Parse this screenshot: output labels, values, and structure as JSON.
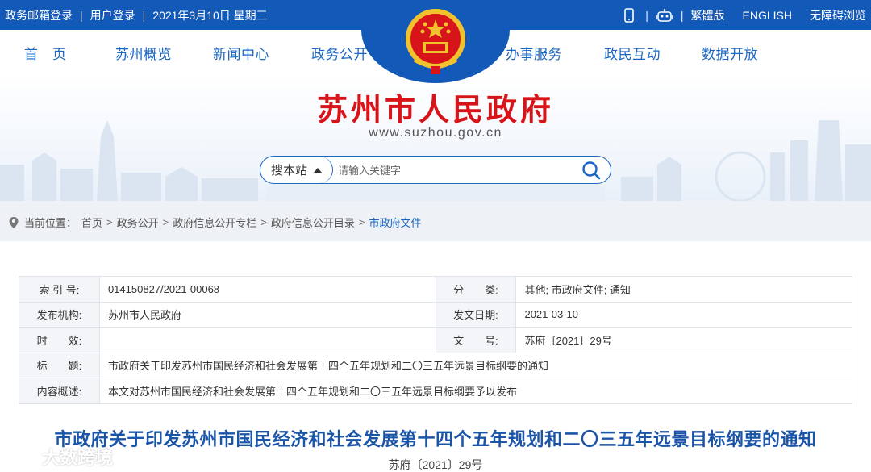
{
  "topbar": {
    "left": [
      "政务邮箱登录",
      "用户登录",
      "2021年3月10日 星期三"
    ],
    "separator": "|",
    "right": {
      "traditional": "繁體版",
      "english": "ENGLISH",
      "accessible": "无障碍浏览"
    }
  },
  "nav": {
    "items": [
      "首　页",
      "苏州概览",
      "新闻中心",
      "政务公开",
      "办事服务",
      "政民互动",
      "数据开放"
    ]
  },
  "header": {
    "title": "苏州市人民政府",
    "url": "www.suzhou.gov.cn"
  },
  "search": {
    "scope": "搜本站",
    "placeholder": "请输入关键字"
  },
  "breadcrumb": {
    "label": "当前位置：",
    "items": [
      "首页",
      "政务公开",
      "政府信息公开专栏",
      "政府信息公开目录"
    ],
    "current": "市政府文件",
    "arrow": ">"
  },
  "info": {
    "index_k": "索 引 号:",
    "index_v": "014150827/2021-00068",
    "cat_k": "分　　类:",
    "cat_v": "其他;  市政府文件;  通知",
    "org_k": "发布机构:",
    "org_v": "苏州市人民政府",
    "date_k": "发文日期:",
    "date_v": "2021-03-10",
    "eff_k": "时　　效:",
    "eff_v": "",
    "no_k": "文　　号:",
    "no_v": "苏府〔2021〕29号",
    "title_k": "标　　题:",
    "title_v": "市政府关于印发苏州市国民经济和社会发展第十四个五年规划和二〇三五年远景目标纲要的通知",
    "summary_k": "内容概述:",
    "summary_v": "本文对苏州市国民经济和社会发展第十四个五年规划和二〇三五年远景目标纲要予以发布"
  },
  "document": {
    "title": "市政府关于印发苏州市国民经济和社会发展第十四个五年规划和二〇三五年远景目标纲要的通知",
    "number": "苏府〔2021〕29号"
  },
  "watermark": {
    "text": "大数跨境"
  },
  "colors": {
    "primary_blue": "#1259b8",
    "title_red": "#d7141a",
    "link_blue": "#1a66c2"
  },
  "icons": [
    "mobile-icon",
    "robot-icon",
    "emblem-icon",
    "search-icon",
    "location-pin-icon"
  ]
}
